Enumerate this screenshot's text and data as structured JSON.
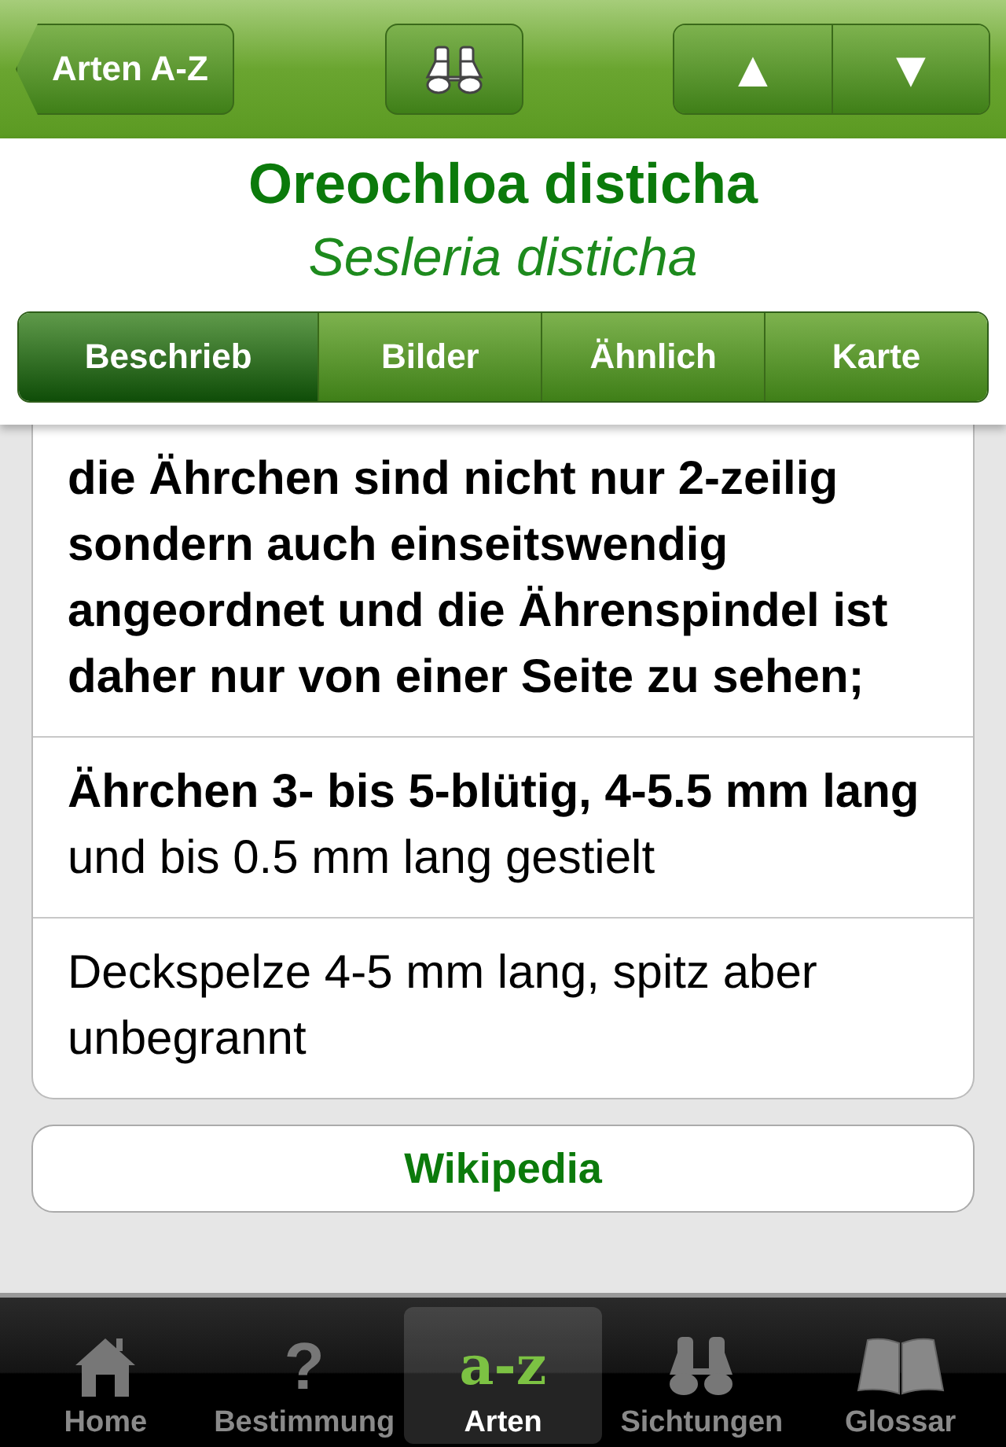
{
  "nav_bar": {
    "back_button": "Arten A-Z",
    "arrow_up": "▲",
    "arrow_down": "▼"
  },
  "header": {
    "title": "Oreochloa disticha",
    "subtitle": "Sesleria disticha"
  },
  "segments": [
    {
      "label": "Beschrieb",
      "selected": true
    },
    {
      "label": "Bilder",
      "selected": false
    },
    {
      "label": "Ähnlich",
      "selected": false
    },
    {
      "label": "Karte",
      "selected": false
    }
  ],
  "description_rows": [
    {
      "text": "die Ährchen sind nicht nur 2-zeilig sondern auch einseitswendig angeordnet und die Ährenspindel ist daher nur von einer Seite zu sehen;",
      "bold": true
    },
    {
      "text": "**Ährchen 3- bis 5-blütig, 4-5.5 mm lang** und bis 0.5 mm lang gestielt",
      "bold": false
    },
    {
      "text": "Deckspelze 4-5 mm lang, spitz aber unbegrannt",
      "bold": false
    }
  ],
  "link_button": "Wikipedia",
  "tab_bar": [
    {
      "label": "Home",
      "kind": "home",
      "selected": false
    },
    {
      "label": "Bestimmung",
      "kind": "glyph",
      "glyph": "?",
      "selected": false
    },
    {
      "label": "Arten",
      "kind": "glyph",
      "glyph": "a-z",
      "selected": true
    },
    {
      "label": "Sichtungen",
      "kind": "binoculars",
      "selected": false
    },
    {
      "label": "Glossar",
      "kind": "book",
      "selected": false
    }
  ]
}
